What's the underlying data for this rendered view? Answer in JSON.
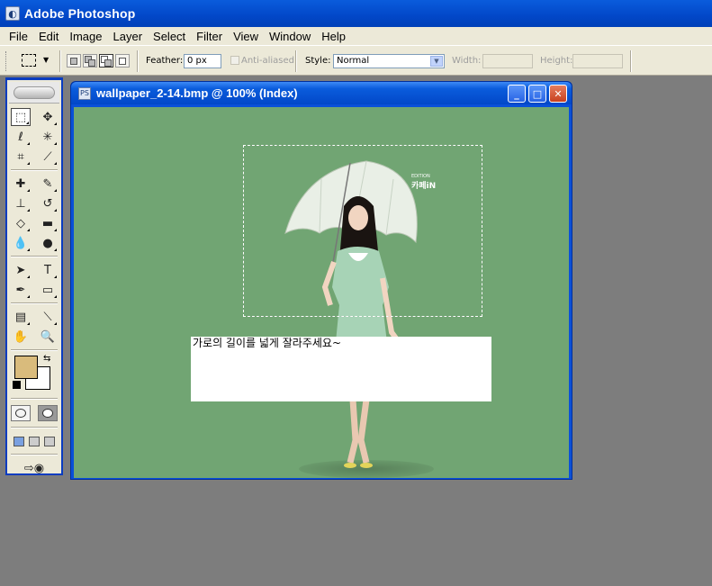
{
  "app": {
    "title": "Adobe Photoshop"
  },
  "menu": [
    "File",
    "Edit",
    "Image",
    "Layer",
    "Select",
    "Filter",
    "View",
    "Window",
    "Help"
  ],
  "options": {
    "feather_label": "Feather:",
    "feather_value": "0 px",
    "anti_aliased_label": "Anti-aliased",
    "style_label": "Style:",
    "style_value": "Normal",
    "width_label": "Width:",
    "height_label": "Height:"
  },
  "document": {
    "title": "wallpaper_2-14.bmp @ 100% (Index)",
    "annotation": "가로의 길이를 넓게 잘라주세요~",
    "watermark_top": "EDITION",
    "watermark_main": "카페iN"
  },
  "colors": {
    "canvas_bg": "#71a573",
    "foreground": "#d9bb7c",
    "background": "#ffffff",
    "titlebar": "#0247c8"
  },
  "icons": [
    "marquee-icon",
    "move-icon",
    "lasso-icon",
    "magic-wand-icon",
    "crop-icon",
    "slice-icon",
    "healing-brush-icon",
    "brush-icon",
    "clone-stamp-icon",
    "history-brush-icon",
    "eraser-icon",
    "gradient-icon",
    "blur-icon",
    "dodge-icon",
    "path-selection-icon",
    "type-icon",
    "pen-icon",
    "shape-icon",
    "notes-icon",
    "eyedropper-icon",
    "hand-icon",
    "zoom-icon"
  ]
}
